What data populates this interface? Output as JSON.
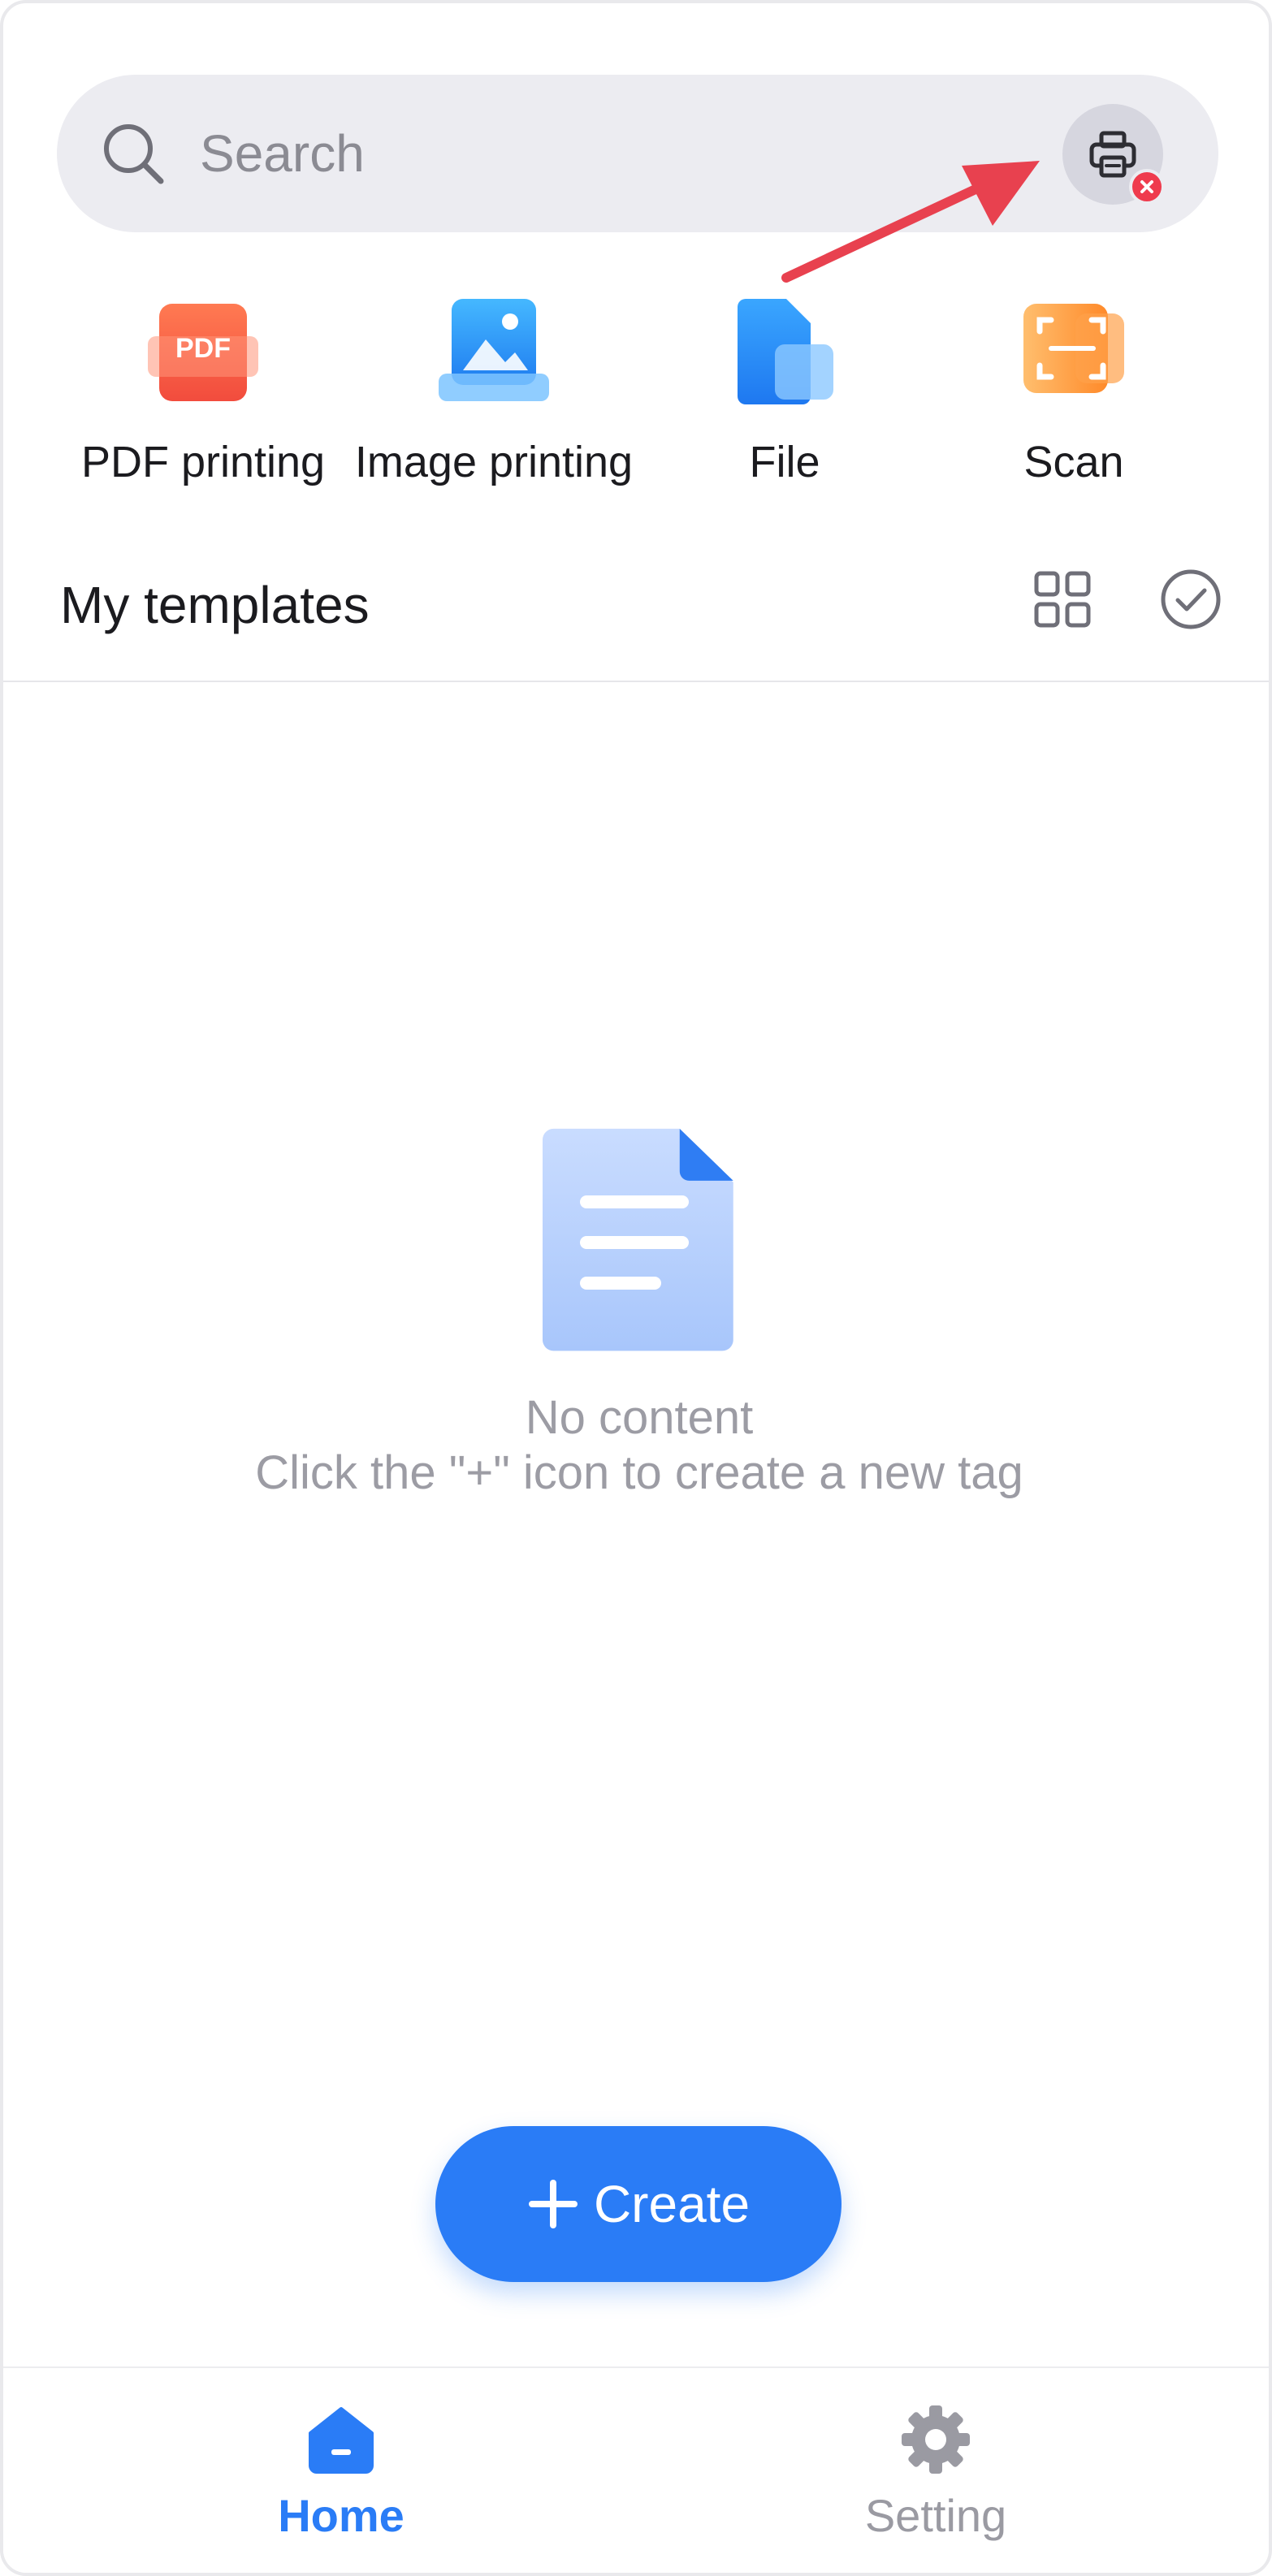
{
  "search": {
    "placeholder": "Search"
  },
  "quick_actions": [
    {
      "label": "PDF printing",
      "icon": "pdf-icon",
      "badge_text": "PDF"
    },
    {
      "label": "Image printing",
      "icon": "image-print-icon"
    },
    {
      "label": "File",
      "icon": "file-folder-icon"
    },
    {
      "label": "Scan",
      "icon": "scan-icon"
    }
  ],
  "templates": {
    "title": "My templates"
  },
  "empty_state": {
    "title": "No content",
    "hint": "Click the \"+\" icon to create a new tag"
  },
  "create_button": {
    "label": "Create"
  },
  "bottom_nav": [
    {
      "label": "Home",
      "icon": "home-icon",
      "active": true
    },
    {
      "label": "Setting",
      "icon": "gear-icon",
      "active": false
    }
  ],
  "colors": {
    "accent": "#2a7cf6",
    "error": "#ef3b4d",
    "annotation_arrow": "#e8414f"
  }
}
